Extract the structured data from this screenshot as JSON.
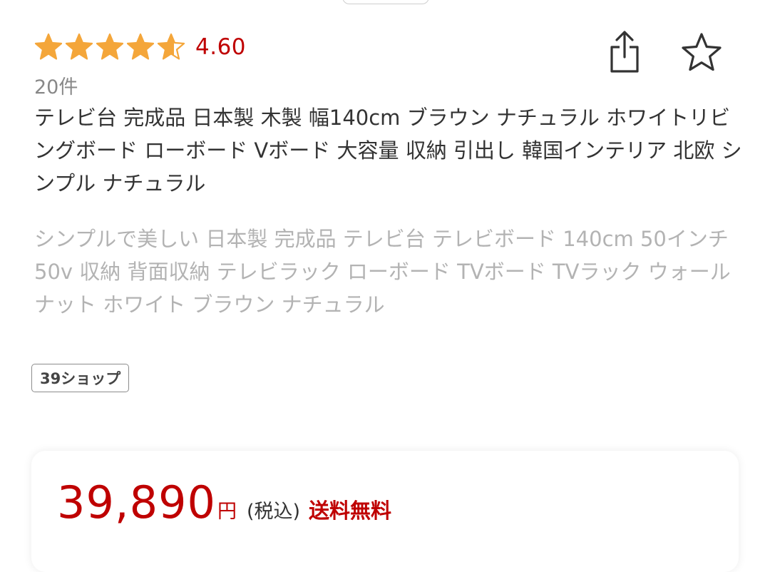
{
  "rating": {
    "stars": 4.6,
    "value": "4.60",
    "review_count": "20件",
    "star_color": "#f4a63a"
  },
  "actions": {
    "share_icon": "share-icon",
    "favorite_icon": "star-outline-icon"
  },
  "product": {
    "title": "テレビ台 完成品 日本製 木製 幅140cm ブラウン ナチュラル ホワイトリビングボード ローボード Vボード 大容量 収納 引出し 韓国インテリア 北欧 シンプル ナチュラル",
    "catch_copy": "シンプルで美しい 日本製 完成品 テレビ台 テレビボード 140cm 50インチ 50v 収納 背面収納 テレビラック ローボード TVボード TVラック ウォールナット ホワイト ブラウン ナチュラル",
    "shop_name": "39ショップ"
  },
  "price": {
    "amount": "39,890",
    "unit": "円",
    "tax_note": "(税込)",
    "shipping": "送料無料",
    "accent_color": "#bf0000"
  }
}
